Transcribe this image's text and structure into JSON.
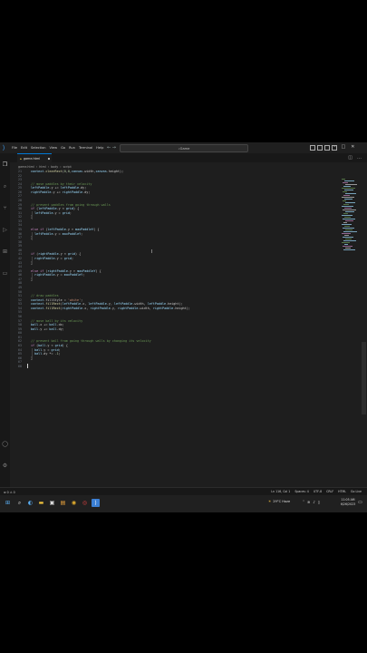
{
  "titlebar": {
    "menu": [
      "File",
      "Edit",
      "Selection",
      "View",
      "Go",
      "Run",
      "Terminal",
      "Help"
    ],
    "search_text": "Game",
    "nav_back_icon": "arrow-left-icon",
    "nav_forward_icon": "arrow-right-icon"
  },
  "tab": {
    "label": "game.html",
    "close": "●"
  },
  "breadcrumb": [
    "game.html",
    "html",
    "body",
    "script"
  ],
  "editor": {
    "line_numbers": [
      "21",
      "22",
      "23",
      "24",
      "25",
      "26",
      "27",
      "28",
      "29",
      "30",
      "31",
      "32",
      "33",
      "34",
      "35",
      "36",
      "37",
      "38",
      "39",
      "40",
      "41",
      "42",
      "43",
      "44",
      "45",
      "46",
      "47",
      "48",
      "49",
      "50",
      "51",
      "52",
      "53",
      "54",
      "55",
      "56",
      "57",
      "58",
      "59",
      "60",
      "61",
      "62",
      "63",
      "64",
      "65",
      "66",
      "67",
      "68",
      "69",
      "70",
      "71",
      "72",
      "73",
      "74",
      "75",
      "76",
      "77",
      "78",
      "79",
      "80",
      "81",
      "82",
      "83",
      "84",
      "85",
      "86",
      "87",
      "88",
      "89",
      "90",
      "91",
      "92",
      "93",
      "94",
      "95",
      "96",
      "97",
      "98",
      "99",
      "100",
      "101",
      "102",
      "103",
      "104",
      "105",
      "106",
      "107"
    ],
    "lines": [
      "context.clearRect(0,0,canvas.width,canvas.height);",
      "",
      "",
      "// move paddles by their velocity",
      "leftPaddle.y += leftPaddle.dy;",
      "rightPaddle.y += rightPaddle.dy;",
      "",
      "",
      "// prevent paddles from going through walls",
      "if (leftPaddle.y < grid) {",
      "  leftPaddle.y = grid;",
      "}",
      "",
      "",
      "else if (leftPaddle.y > maxPaddleY) {",
      "  leftPaddle.y = maxPaddleY;",
      "}",
      "",
      "",
      "",
      "if (rightPaddle.y < grid) {",
      "  rightPaddle.y = grid;",
      "}",
      "",
      "else if (rightPaddle.y > maxPaddleY) {",
      "  rightPaddle.y = maxPaddleY;",
      "}",
      "",
      "",
      "",
      "// draw paddles",
      "context.fillStyle = 'white';",
      "context.fillRect(leftPaddle.x, leftPaddle.y, leftPaddle.width, leftPaddle.height);",
      "context.fillRect(rightPaddle.x, rightPaddle.y, rightPaddle.width, rightPaddle.height);",
      "",
      "",
      "// move ball by its velocity",
      "ball.x += ball.dx;",
      "ball.y += ball.dy;",
      "",
      "",
      "// prevent ball from going through walls by changing its velocity",
      "if (ball.y < grid) {",
      "  ball.y = grid;",
      "  ball.dy *= -1;",
      "}",
      "",
      ""
    ]
  },
  "statusbar": {
    "left": [
      "⊗ 0 ⚠ 0"
    ],
    "right": [
      "Ln 116, Col 1",
      "Spaces: 4",
      "UTF-8",
      "CRLF",
      "HTML",
      "Go Live"
    ]
  },
  "taskbar": {
    "weather": "29°C Haze",
    "time": "11:05 AM",
    "date": "6/26/2023"
  },
  "colors": {
    "editor_bg": "#1e1e1e",
    "comment": "#6a9955",
    "keyword": "#c586c0",
    "variable": "#9cdcfe",
    "accent": "#0078d4"
  }
}
